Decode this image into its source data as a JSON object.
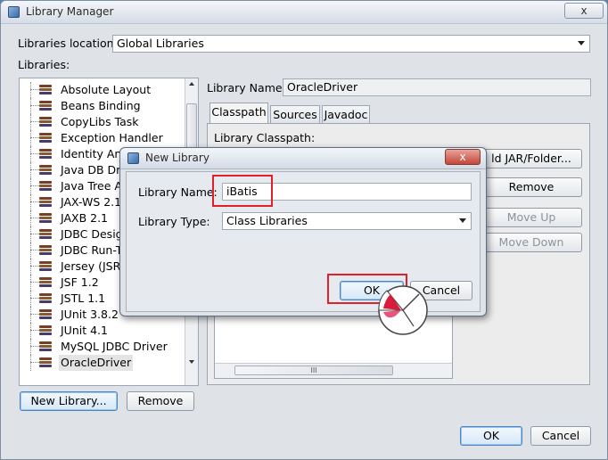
{
  "window": {
    "title": "Library Manager",
    "close_label": "x"
  },
  "location": {
    "label": "Libraries location:",
    "value": "Global Libraries"
  },
  "libraries_label": "Libraries:",
  "libraries": [
    {
      "label": "Absolute Layout"
    },
    {
      "label": "Beans Binding"
    },
    {
      "label": "CopyLibs Task"
    },
    {
      "label": "Exception Handler"
    },
    {
      "label": "Identity Ant T"
    },
    {
      "label": "Java DB Driv"
    },
    {
      "label": "Java Tree A"
    },
    {
      "label": "JAX-WS 2.1"
    },
    {
      "label": "JAXB 2.1"
    },
    {
      "label": "JDBC Desig"
    },
    {
      "label": "JDBC Run-T"
    },
    {
      "label": "Jersey (JSR"
    },
    {
      "label": "JSF 1.2"
    },
    {
      "label": "JSTL 1.1"
    },
    {
      "label": "JUnit 3.8.2"
    },
    {
      "label": "JUnit 4.1"
    },
    {
      "label": "MySQL JDBC Driver"
    },
    {
      "label": "OracleDriver"
    }
  ],
  "library_name": {
    "label": "Library Name:",
    "value": "OracleDriver"
  },
  "tabs": [
    {
      "label": "Classpath"
    },
    {
      "label": "Sources"
    },
    {
      "label": "Javadoc"
    }
  ],
  "classpath": {
    "label": "Library Classpath:",
    "add_jar_label": "ld JAR/Folder...",
    "remove_label": "Remove",
    "move_up_label": "Move Up",
    "move_down_label": "Move Down"
  },
  "scroll_grip": "III",
  "bottom_buttons": {
    "new_library": "New Library...",
    "remove": "Remove",
    "ok": "OK",
    "cancel": "Cancel"
  },
  "dialog": {
    "title": "New Library",
    "close_label": "x",
    "name_label": "Library Name:",
    "name_value": "iBatis",
    "type_label": "Library Type:",
    "type_value": "Class Libraries",
    "ok": "OK",
    "cancel": "Cancel"
  },
  "colors": {
    "highlight_red": "#e0202a",
    "focus_blue": "#4b86c4"
  }
}
